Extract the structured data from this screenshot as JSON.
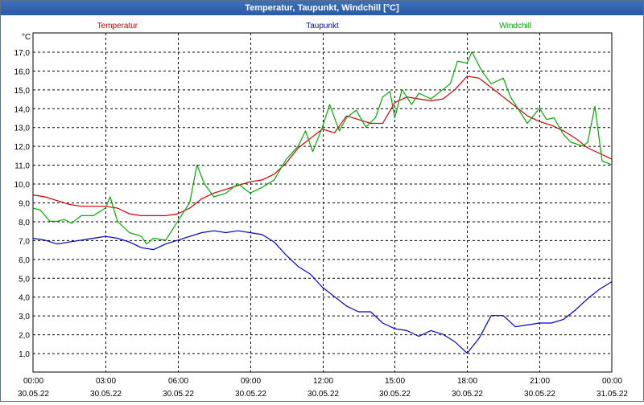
{
  "window": {
    "title": "Temperatur, Taupunkt, Windchill [°C]"
  },
  "chart_data": {
    "type": "line",
    "title": "Temperatur, Taupunkt, Windchill [°C]",
    "ylabel": "°C",
    "ylim": [
      0,
      18
    ],
    "xlim": [
      0,
      24
    ],
    "yticks": [
      "1,0",
      "2,0",
      "3,0",
      "4,0",
      "5,0",
      "6,0",
      "7,0",
      "8,0",
      "9,0",
      "10,0",
      "11,0",
      "12,0",
      "13,0",
      "14,0",
      "15,0",
      "16,0",
      "17,0"
    ],
    "x_tick_labels": [
      {
        "time": "00:00",
        "date": "30.05.22"
      },
      {
        "time": "03:00",
        "date": "30.05.22"
      },
      {
        "time": "06:00",
        "date": "30.05.22"
      },
      {
        "time": "09:00",
        "date": "30.05.22"
      },
      {
        "time": "12:00",
        "date": "30.05.22"
      },
      {
        "time": "15:00",
        "date": "30.05.22"
      },
      {
        "time": "18:00",
        "date": "30.05.22"
      },
      {
        "time": "21:00",
        "date": "30.05.22"
      },
      {
        "time": "00:00",
        "date": "31.05.22"
      }
    ],
    "grid": true,
    "series": [
      {
        "name": "Temperatur",
        "color": "#cc0000",
        "points": [
          [
            0,
            9.4
          ],
          [
            0.5,
            9.3
          ],
          [
            1,
            9.1
          ],
          [
            1.5,
            8.9
          ],
          [
            2,
            8.8
          ],
          [
            2.5,
            8.8
          ],
          [
            3,
            8.8
          ],
          [
            3.5,
            8.7
          ],
          [
            4,
            8.4
          ],
          [
            4.5,
            8.3
          ],
          [
            5,
            8.3
          ],
          [
            5.5,
            8.3
          ],
          [
            6,
            8.4
          ],
          [
            6.5,
            8.7
          ],
          [
            7,
            9.2
          ],
          [
            7.5,
            9.5
          ],
          [
            8,
            9.7
          ],
          [
            8.5,
            9.9
          ],
          [
            9,
            10.1
          ],
          [
            9.5,
            10.2
          ],
          [
            10,
            10.5
          ],
          [
            10.5,
            11.1
          ],
          [
            11,
            11.9
          ],
          [
            11.5,
            12.4
          ],
          [
            12,
            12.9
          ],
          [
            12.5,
            12.7
          ],
          [
            13,
            13.6
          ],
          [
            13.5,
            13.4
          ],
          [
            14,
            13.2
          ],
          [
            14.5,
            13.2
          ],
          [
            15,
            14.3
          ],
          [
            15.5,
            14.6
          ],
          [
            16,
            14.5
          ],
          [
            16.5,
            14.4
          ],
          [
            17,
            14.5
          ],
          [
            17.5,
            15.0
          ],
          [
            18,
            15.7
          ],
          [
            18.5,
            15.6
          ],
          [
            19,
            15.1
          ],
          [
            19.5,
            14.6
          ],
          [
            20,
            14.1
          ],
          [
            20.5,
            13.6
          ],
          [
            21,
            13.3
          ],
          [
            21.5,
            13.1
          ],
          [
            22,
            12.8
          ],
          [
            22.5,
            12.4
          ],
          [
            23,
            11.9
          ],
          [
            23.5,
            11.6
          ],
          [
            24,
            11.3
          ]
        ]
      },
      {
        "name": "Taupunkt",
        "color": "#0000cc",
        "points": [
          [
            0,
            7.1
          ],
          [
            0.5,
            7.0
          ],
          [
            1,
            6.8
          ],
          [
            1.5,
            6.9
          ],
          [
            2,
            7.0
          ],
          [
            2.5,
            7.1
          ],
          [
            3,
            7.2
          ],
          [
            3.5,
            7.1
          ],
          [
            4,
            6.9
          ],
          [
            4.5,
            6.6
          ],
          [
            5,
            6.5
          ],
          [
            5.5,
            6.8
          ],
          [
            6,
            7.0
          ],
          [
            6.5,
            7.2
          ],
          [
            7,
            7.4
          ],
          [
            7.5,
            7.5
          ],
          [
            8,
            7.4
          ],
          [
            8.5,
            7.5
          ],
          [
            9,
            7.4
          ],
          [
            9.5,
            7.3
          ],
          [
            10,
            6.9
          ],
          [
            10.5,
            6.2
          ],
          [
            11,
            5.6
          ],
          [
            11.5,
            5.2
          ],
          [
            12,
            4.5
          ],
          [
            12.5,
            4.0
          ],
          [
            13,
            3.5
          ],
          [
            13.5,
            3.2
          ],
          [
            14,
            3.2
          ],
          [
            14.5,
            2.6
          ],
          [
            15,
            2.3
          ],
          [
            15.5,
            2.2
          ],
          [
            16,
            1.9
          ],
          [
            16.5,
            2.2
          ],
          [
            17,
            2.0
          ],
          [
            17.5,
            1.6
          ],
          [
            18,
            1.0
          ],
          [
            18.5,
            1.8
          ],
          [
            19,
            3.0
          ],
          [
            19.5,
            3.0
          ],
          [
            20,
            2.4
          ],
          [
            20.5,
            2.5
          ],
          [
            21,
            2.6
          ],
          [
            21.5,
            2.6
          ],
          [
            22,
            2.8
          ],
          [
            22.5,
            3.3
          ],
          [
            23,
            3.9
          ],
          [
            23.5,
            4.4
          ],
          [
            24,
            4.8
          ]
        ]
      },
      {
        "name": "Windchill",
        "color": "#00aa00",
        "points": [
          [
            0,
            8.7
          ],
          [
            0.3,
            8.6
          ],
          [
            0.7,
            8.0
          ],
          [
            1,
            8.0
          ],
          [
            1.3,
            8.1
          ],
          [
            1.6,
            7.9
          ],
          [
            2,
            8.3
          ],
          [
            2.5,
            8.3
          ],
          [
            3,
            8.7
          ],
          [
            3.2,
            9.3
          ],
          [
            3.5,
            8.0
          ],
          [
            4,
            7.4
          ],
          [
            4.5,
            7.2
          ],
          [
            4.7,
            6.8
          ],
          [
            5,
            7.1
          ],
          [
            5.5,
            7.0
          ],
          [
            6,
            8.0
          ],
          [
            6.5,
            9.0
          ],
          [
            6.8,
            11.0
          ],
          [
            7.1,
            10.0
          ],
          [
            7.5,
            9.3
          ],
          [
            8,
            9.5
          ],
          [
            8.5,
            10.0
          ],
          [
            9,
            9.5
          ],
          [
            9.5,
            9.8
          ],
          [
            10,
            10.2
          ],
          [
            10.5,
            11.3
          ],
          [
            11,
            12.0
          ],
          [
            11.3,
            12.8
          ],
          [
            11.6,
            11.7
          ],
          [
            12,
            13.0
          ],
          [
            12.3,
            14.2
          ],
          [
            12.7,
            12.8
          ],
          [
            13,
            13.5
          ],
          [
            13.4,
            13.9
          ],
          [
            13.8,
            13.0
          ],
          [
            14.2,
            13.5
          ],
          [
            14.5,
            14.6
          ],
          [
            14.8,
            14.9
          ],
          [
            15,
            13.5
          ],
          [
            15.3,
            15.0
          ],
          [
            15.7,
            14.2
          ],
          [
            16,
            14.8
          ],
          [
            16.5,
            14.5
          ],
          [
            17,
            15.0
          ],
          [
            17.3,
            15.3
          ],
          [
            17.6,
            16.5
          ],
          [
            18,
            16.4
          ],
          [
            18.2,
            17.0
          ],
          [
            18.6,
            16.0
          ],
          [
            19,
            15.3
          ],
          [
            19.5,
            15.6
          ],
          [
            19.8,
            14.6
          ],
          [
            20.1,
            14.0
          ],
          [
            20.5,
            13.2
          ],
          [
            21,
            14.0
          ],
          [
            21.3,
            13.4
          ],
          [
            21.6,
            13.5
          ],
          [
            22,
            12.6
          ],
          [
            22.3,
            12.2
          ],
          [
            22.8,
            12.0
          ],
          [
            23,
            12.2
          ],
          [
            23.3,
            14.1
          ],
          [
            23.6,
            11.2
          ],
          [
            24,
            11.0
          ]
        ]
      }
    ]
  }
}
